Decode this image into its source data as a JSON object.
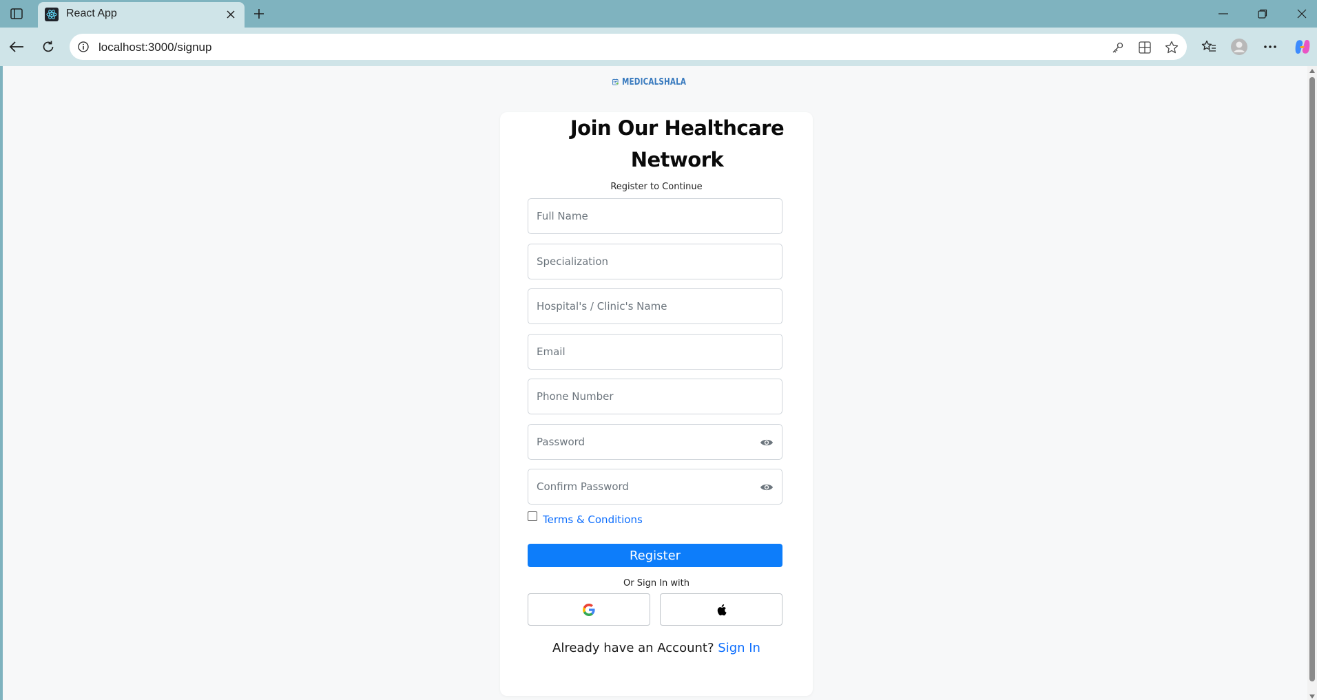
{
  "browser": {
    "tab_title": "React App",
    "url": "localhost:3000/signup"
  },
  "page": {
    "logo_text": "MEDICALSHALA",
    "heading": "Join Our Healthcare Network",
    "subheading": "Register to Continue",
    "fields": {
      "full_name": "Full Name",
      "specialization": "Specialization",
      "hospital": "Hospital's / Clinic's Name",
      "email": "Email",
      "phone": "Phone Number",
      "password": "Password",
      "confirm_password": "Confirm Password"
    },
    "terms_label": "Terms & Conditions",
    "register_label": "Register",
    "or_text": "Or Sign In with",
    "already_text": "Already have an Account?",
    "signin_label": "Sign In"
  },
  "colors": {
    "primary": "#0d7dfa",
    "link": "#0d6efd",
    "chrome": "#7fb3bf",
    "page_bg": "#f7f8f9"
  },
  "icons": {
    "google": "google-icon",
    "apple": "apple-icon",
    "password_toggle": "eye-icon"
  }
}
